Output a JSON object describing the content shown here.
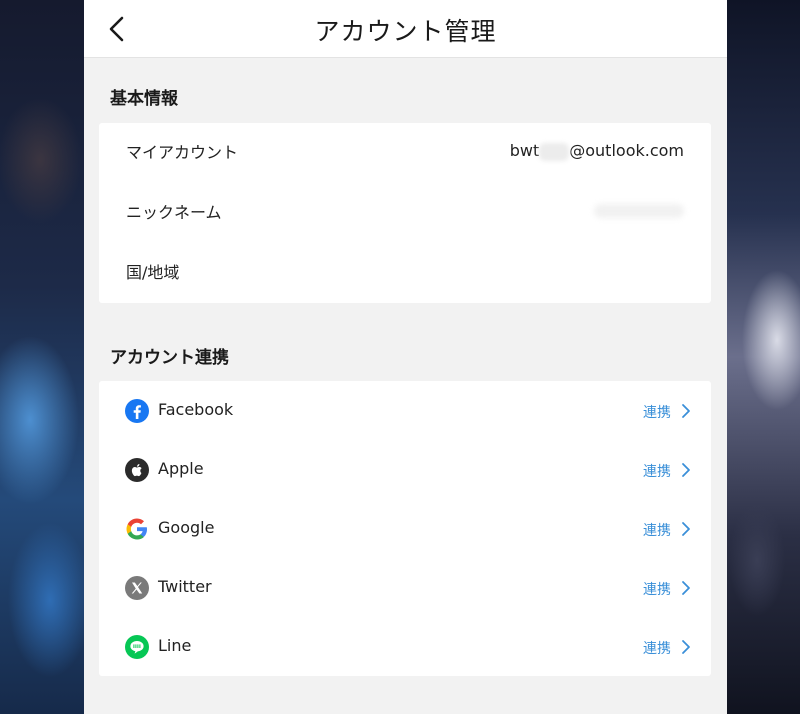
{
  "header": {
    "title": "アカウント管理"
  },
  "basic_info": {
    "section_title": "基本情報",
    "rows": [
      {
        "label": "マイアカウント",
        "value_prefix": "bwt",
        "value_suffix": "@outlook.com"
      },
      {
        "label": "ニックネーム"
      },
      {
        "label": "国/地域"
      }
    ]
  },
  "linking": {
    "section_title": "アカウント連携",
    "items": [
      {
        "label": "Facebook",
        "action": "連携",
        "icon": "facebook-icon",
        "color": "#1877f2"
      },
      {
        "label": "Apple",
        "action": "連携",
        "icon": "apple-icon",
        "color": "#2b2b2b"
      },
      {
        "label": "Google",
        "action": "連携",
        "icon": "google-icon",
        "color": "#4285f4"
      },
      {
        "label": "Twitter",
        "action": "連携",
        "icon": "twitter-x-icon",
        "color": "#7a7a7a"
      },
      {
        "label": "Line",
        "action": "連携",
        "icon": "line-icon",
        "color": "#06c755"
      }
    ]
  },
  "colors": {
    "accent": "#3a8fd8",
    "panel_bg": "#f2f2f2",
    "card_bg": "#ffffff"
  }
}
